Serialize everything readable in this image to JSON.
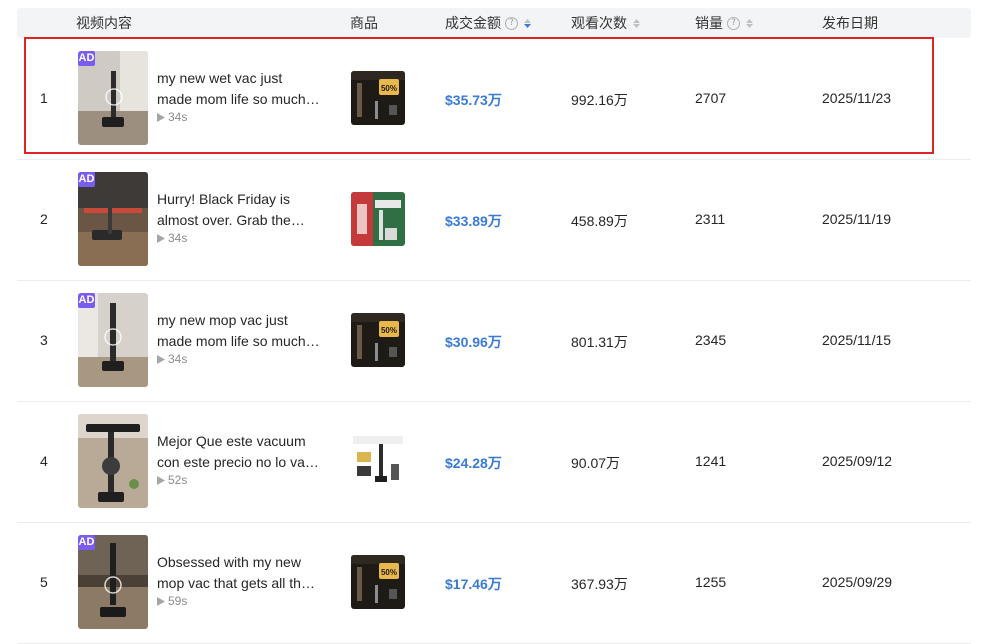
{
  "header": {
    "video_content": "视频内容",
    "product": "商品",
    "gmv": "成交金额",
    "views": "观看次数",
    "sales": "销量",
    "publish_date": "发布日期"
  },
  "accent_color": "#3a7bd5",
  "highlight_color": "#e02424",
  "ad_badge_color": "#7b5cf0",
  "rows": [
    {
      "index": "1",
      "ad": "AD",
      "title_line1": "my new wet vac just",
      "title_line2": "made mom life so much…",
      "duration": "34s",
      "gmv": "$35.73万",
      "views": "992.16万",
      "sales": "2707",
      "date": "2025/11/23"
    },
    {
      "index": "2",
      "ad": "AD",
      "title_line1": "Hurry! Black Friday is",
      "title_line2": "almost over. Grab the…",
      "duration": "34s",
      "gmv": "$33.89万",
      "views": "458.89万",
      "sales": "2311",
      "date": "2025/11/19"
    },
    {
      "index": "3",
      "ad": "AD",
      "title_line1": "my new mop vac just",
      "title_line2": "made mom life so much…",
      "duration": "34s",
      "gmv": "$30.96万",
      "views": "801.31万",
      "sales": "2345",
      "date": "2025/11/15"
    },
    {
      "index": "4",
      "ad": "",
      "title_line1": "Mejor Que este vacuum",
      "title_line2": "con este precio no lo va…",
      "duration": "52s",
      "gmv": "$24.28万",
      "views": "90.07万",
      "sales": "1241",
      "date": "2025/09/12"
    },
    {
      "index": "5",
      "ad": "AD",
      "title_line1": "Obsessed with my new",
      "title_line2": "mop vac that gets all th…",
      "duration": "59s",
      "gmv": "$17.46万",
      "views": "367.93万",
      "sales": "1255",
      "date": "2025/09/29"
    }
  ]
}
